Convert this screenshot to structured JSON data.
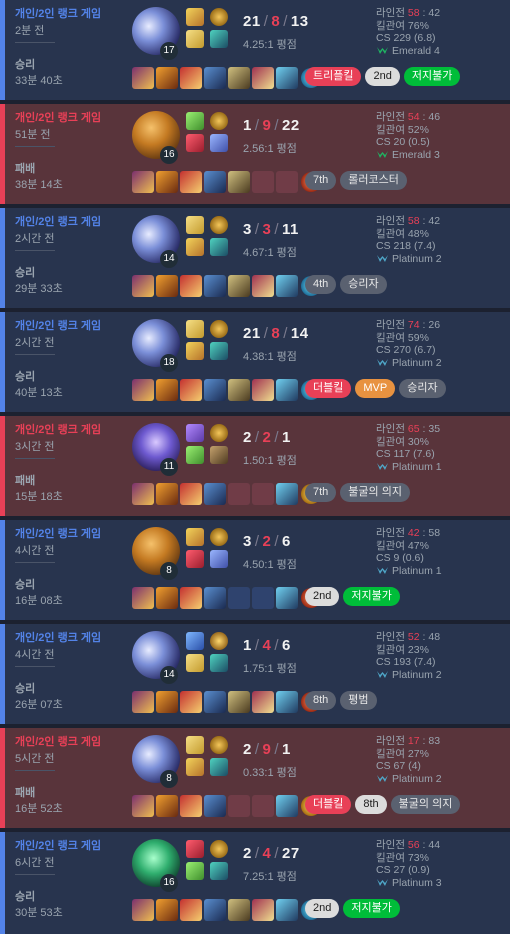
{
  "matches": [
    {
      "result": "win",
      "queue": "개인/2인 랭크 게임",
      "ago": "2분 전",
      "outcome": "승리",
      "duration": "33분 40초",
      "champ": "c-ahri",
      "level": "17",
      "spells": [
        "spell-ignite",
        "spell-flash"
      ],
      "runes": [
        "rune-gold",
        "rune-blue"
      ],
      "kills": "21",
      "deaths": "8",
      "assists": "13",
      "ratio": "4.25:1 평점",
      "items": [
        "i1",
        "i2",
        "i3",
        "i4",
        "i5",
        "i6",
        "i7"
      ],
      "ward": "ward-blue",
      "badges": [
        {
          "text": "트리플킬",
          "style": "red"
        },
        {
          "text": "2nd",
          "style": "light"
        },
        {
          "text": "저지불가",
          "style": "green"
        }
      ],
      "lane_label": "라인전",
      "lane_left": "58",
      "lane_sep": " : ",
      "lane_right": "42",
      "kp": "킬관여 76%",
      "cs": "CS 229 (6.8)",
      "tier": "Emerald 4",
      "tier_color": "#1fb562"
    },
    {
      "result": "loss",
      "queue": "개인/2인 랭크 게임",
      "ago": "51분 전",
      "outcome": "패배",
      "duration": "38분 14초",
      "champ": "c-ziggs",
      "level": "16",
      "spells": [
        "spell-green",
        "spell-red"
      ],
      "runes": [
        "rune-gold",
        "rune-violet"
      ],
      "kills": "1",
      "deaths": "9",
      "assists": "22",
      "ratio": "2.56:1 평점",
      "items": [
        "i1",
        "i2",
        "i3",
        "i4",
        "i5",
        "empty",
        "empty"
      ],
      "ward": "ward-red",
      "badges": [
        {
          "text": "7th",
          "style": "grey"
        },
        {
          "text": "롤러코스터",
          "style": "grey"
        }
      ],
      "lane_label": "라인전",
      "lane_left": "54",
      "lane_sep": " : ",
      "lane_right": "46",
      "kp": "킬관여 52%",
      "cs": "CS 20 (0.5)",
      "tier": "Emerald 3",
      "tier_color": "#1fb562"
    },
    {
      "result": "win",
      "queue": "개인/2인 랭크 게임",
      "ago": "2시간 전",
      "outcome": "승리",
      "duration": "29분 33초",
      "champ": "c-ahri",
      "level": "14",
      "spells": [
        "spell-flash",
        "spell-ignite"
      ],
      "runes": [
        "rune-gold",
        "rune-blue"
      ],
      "kills": "3",
      "deaths": "3",
      "assists": "11",
      "ratio": "4.67:1 평점",
      "items": [
        "i1",
        "i2",
        "i3",
        "i4",
        "i5",
        "i6",
        "i7"
      ],
      "ward": "ward-blue",
      "badges": [
        {
          "text": "4th",
          "style": "grey"
        },
        {
          "text": "승리자",
          "style": "grey"
        }
      ],
      "lane_label": "라인전",
      "lane_left": "58",
      "lane_sep": " : ",
      "lane_right": "42",
      "kp": "킬관여 48%",
      "cs": "CS 218 (7.4)",
      "tier": "Platinum 2",
      "tier_color": "#4fa7c9"
    },
    {
      "result": "win",
      "queue": "개인/2인 랭크 게임",
      "ago": "2시간 전",
      "outcome": "승리",
      "duration": "40분 13초",
      "champ": "c-ahri",
      "level": "18",
      "spells": [
        "spell-flash",
        "spell-ignite"
      ],
      "runes": [
        "rune-gold",
        "rune-blue"
      ],
      "kills": "21",
      "deaths": "8",
      "assists": "14",
      "ratio": "4.38:1 평점",
      "items": [
        "i1",
        "i2",
        "i3",
        "i4",
        "i5",
        "i6",
        "i7"
      ],
      "ward": "ward-blue",
      "badges": [
        {
          "text": "더블킬",
          "style": "red"
        },
        {
          "text": "MVP",
          "style": "orange"
        },
        {
          "text": "승리자",
          "style": "grey"
        }
      ],
      "lane_label": "라인전",
      "lane_left": "74",
      "lane_sep": " : ",
      "lane_right": "26",
      "kp": "킬관여 59%",
      "cs": "CS 270 (6.7)",
      "tier": "Platinum 2",
      "tier_color": "#4fa7c9"
    },
    {
      "result": "loss",
      "queue": "개인/2인 랭크 게임",
      "ago": "3시간 전",
      "outcome": "패배",
      "duration": "15분 18초",
      "champ": "c-kayn",
      "level": "11",
      "spells": [
        "spell-purple",
        "spell-green"
      ],
      "runes": [
        "rune-gold",
        "rune-dark"
      ],
      "kills": "2",
      "deaths": "2",
      "assists": "1",
      "ratio": "1.50:1 평점",
      "items": [
        "i1",
        "i2",
        "i3",
        "i4",
        "empty",
        "empty",
        "i7"
      ],
      "ward": "ward-gold",
      "badges": [
        {
          "text": "7th",
          "style": "grey"
        },
        {
          "text": "불굴의 의지",
          "style": "grey"
        }
      ],
      "lane_label": "라인전",
      "lane_left": "65",
      "lane_sep": " : ",
      "lane_right": "35",
      "kp": "킬관여 30%",
      "cs": "CS 117 (7.6)",
      "tier": "Platinum 1",
      "tier_color": "#4fa7c9"
    },
    {
      "result": "win",
      "queue": "개인/2인 랭크 게임",
      "ago": "4시간 전",
      "outcome": "승리",
      "duration": "16분 08초",
      "champ": "c-ziggs",
      "level": "8",
      "spells": [
        "spell-ignite",
        "spell-red"
      ],
      "runes": [
        "rune-gold",
        "rune-violet"
      ],
      "kills": "3",
      "deaths": "2",
      "assists": "6",
      "ratio": "4.50:1 평점",
      "items": [
        "i1",
        "i2",
        "i3",
        "i4",
        "empty",
        "empty",
        "i7"
      ],
      "ward": "ward-red",
      "badges": [
        {
          "text": "2nd",
          "style": "light"
        },
        {
          "text": "저지불가",
          "style": "green"
        }
      ],
      "lane_label": "라인전",
      "lane_left": "42",
      "lane_sep": " : ",
      "lane_right": "58",
      "kp": "킬관여 47%",
      "cs": "CS 9 (0.6)",
      "tier": "Platinum 1",
      "tier_color": "#4fa7c9"
    },
    {
      "result": "win",
      "queue": "개인/2인 랭크 게임",
      "ago": "4시간 전",
      "outcome": "승리",
      "duration": "26분 07초",
      "champ": "c-ahri",
      "level": "14",
      "spells": [
        "spell-smite",
        "spell-flash"
      ],
      "runes": [
        "rune-lotus",
        "rune-blue"
      ],
      "kills": "1",
      "deaths": "4",
      "assists": "6",
      "ratio": "1.75:1 평점",
      "items": [
        "i1",
        "i2",
        "i3",
        "i4",
        "i5",
        "i6",
        "i7"
      ],
      "ward": "ward-red",
      "badges": [
        {
          "text": "8th",
          "style": "grey"
        },
        {
          "text": "평범",
          "style": "grey"
        }
      ],
      "lane_label": "라인전",
      "lane_left": "52",
      "lane_sep": " : ",
      "lane_right": "48",
      "kp": "킬관여 23%",
      "cs": "CS 193 (7.4)",
      "tier": "Platinum 2",
      "tier_color": "#4fa7c9"
    },
    {
      "result": "loss",
      "queue": "개인/2인 랭크 게임",
      "ago": "5시간 전",
      "outcome": "패배",
      "duration": "16분 52초",
      "champ": "c-ahri",
      "level": "8",
      "spells": [
        "spell-flash",
        "spell-ignite"
      ],
      "runes": [
        "rune-gold",
        "rune-blue"
      ],
      "kills": "2",
      "deaths": "9",
      "assists": "1",
      "ratio": "0.33:1 평점",
      "items": [
        "i1",
        "i2",
        "i3",
        "i4",
        "empty",
        "empty",
        "i7"
      ],
      "ward": "ward-gold",
      "badges": [
        {
          "text": "더블킬",
          "style": "red"
        },
        {
          "text": "8th",
          "style": "light"
        },
        {
          "text": "불굴의 의지",
          "style": "grey"
        }
      ],
      "lane_label": "라인전",
      "lane_left": "17",
      "lane_sep": " : ",
      "lane_right": "83",
      "kp": "킬관여 27%",
      "cs": "CS 67 (4)",
      "tier": "Platinum 2",
      "tier_color": "#4fa7c9"
    },
    {
      "result": "win",
      "queue": "개인/2인 랭크 게임",
      "ago": "6시간 전",
      "outcome": "승리",
      "duration": "30분 53초",
      "champ": "c-green",
      "level": "16",
      "spells": [
        "spell-red",
        "spell-green"
      ],
      "runes": [
        "rune-gold",
        "rune-blue"
      ],
      "kills": "2",
      "deaths": "4",
      "assists": "27",
      "ratio": "7.25:1 평점",
      "items": [
        "i1",
        "i2",
        "i3",
        "i4",
        "i5",
        "i6",
        "i7"
      ],
      "ward": "ward-blue",
      "badges": [
        {
          "text": "2nd",
          "style": "light"
        },
        {
          "text": "저지불가",
          "style": "green"
        }
      ],
      "lane_label": "라인전",
      "lane_left": "56",
      "lane_sep": " : ",
      "lane_right": "44",
      "kp": "킬관여 73%",
      "cs": "CS 27 (0.9)",
      "tier": "Platinum 3",
      "tier_color": "#4fa7c9"
    }
  ]
}
